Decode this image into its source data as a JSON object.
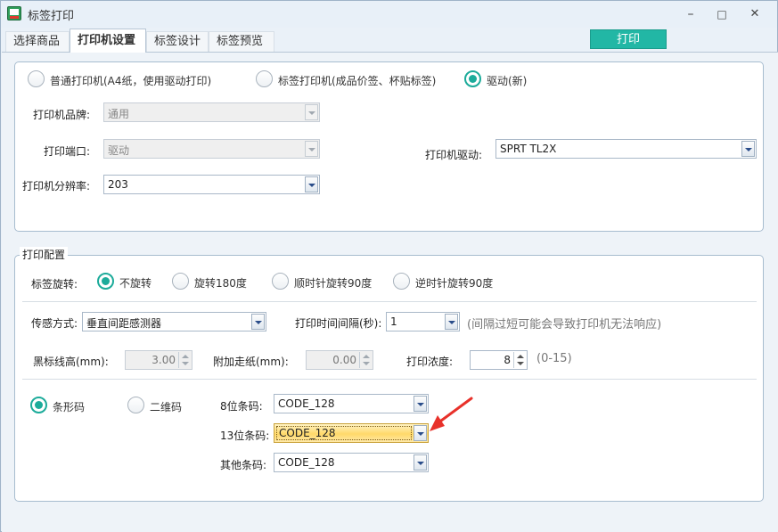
{
  "window": {
    "title": "标签打印",
    "minimize_label": "–",
    "maximize_label": "□",
    "close_label": "✕"
  },
  "tabs": [
    {
      "label": "选择商品",
      "active": false
    },
    {
      "label": "打印机设置",
      "active": true
    },
    {
      "label": "标签设计",
      "active": false
    },
    {
      "label": "标签预览",
      "active": false
    }
  ],
  "print_button": "打印",
  "printer_setup": {
    "mode_options": [
      {
        "label": "普通打印机(A4纸，使用驱动打印)",
        "checked": false
      },
      {
        "label": "标签打印机(成品价签、杯贴标签)",
        "checked": false
      },
      {
        "label": "驱动(新)",
        "checked": true
      }
    ],
    "brand_label": "打印机品牌:",
    "brand_value": "通用",
    "port_label": "打印端口:",
    "port_value": "驱动",
    "resolution_label": "打印机分辨率:",
    "resolution_value": "203",
    "driver_label": "打印机驱动:",
    "driver_value": "SPRT TL2X"
  },
  "print_config": {
    "group_title": "打印配置",
    "rotation_label": "标签旋转:",
    "rotation_options": [
      {
        "label": "不旋转",
        "checked": true
      },
      {
        "label": "旋转180度",
        "checked": false
      },
      {
        "label": "顺时针旋转90度",
        "checked": false
      },
      {
        "label": "逆时针旋转90度",
        "checked": false
      }
    ],
    "sensor_label": "传感方式:",
    "sensor_value": "垂直间距感测器",
    "interval_label": "打印时间间隔(秒):",
    "interval_value": "1",
    "interval_hint": "(间隔过短可能会导致打印机无法响应)",
    "black_mark_label": "黑标线高(mm):",
    "black_mark_value": "3.00",
    "feed_label": "附加走纸(mm):",
    "feed_value": "0.00",
    "density_label": "打印浓度:",
    "density_value": "8",
    "density_hint": "(0-15)",
    "code_type_options": [
      {
        "label": "条形码",
        "checked": true
      },
      {
        "label": "二维码",
        "checked": false
      }
    ],
    "barcode8_label": "8位条码:",
    "barcode8_value": "CODE_128",
    "barcode13_label": "13位条码:",
    "barcode13_value": "CODE_128",
    "barcode_other_label": "其他条码:",
    "barcode_other_value": "CODE_128"
  },
  "colors": {
    "accent": "#1cab9a",
    "print_button_bg": "#22b7a5",
    "highlight": "#ffd96a",
    "annotation_arrow": "#e8312a"
  }
}
